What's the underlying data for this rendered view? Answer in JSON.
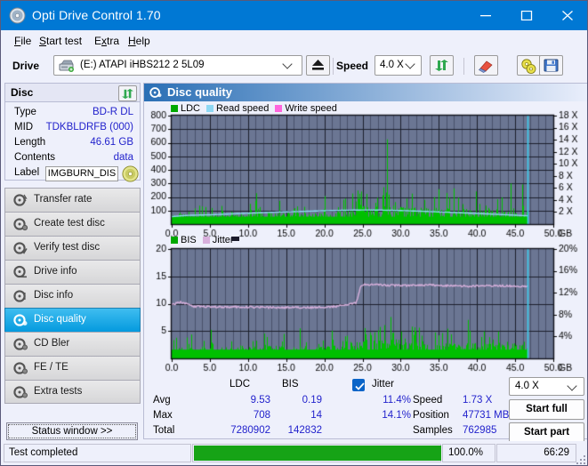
{
  "window": {
    "title": "Opti Drive Control 1.70",
    "icon": "disc-icon",
    "minimize_label": "Minimize",
    "maximize_label": "Maximize",
    "close_label": "Close"
  },
  "menu": [
    {
      "label": "File",
      "accel": "F"
    },
    {
      "label": "Start test",
      "accel": "S"
    },
    {
      "label": "Extra",
      "accel": "x"
    },
    {
      "label": "Help",
      "accel": "H"
    }
  ],
  "toolbar": {
    "drive_label": "Drive",
    "drive_value": "(E:)   ATAPI iHBS212   2 5L09",
    "eject_icon": "eject-icon",
    "speed_label": "Speed",
    "speed_value": "4.0 X",
    "refresh_icon": "refresh-icon",
    "erase_icon": "eraser-icon",
    "disc_tools_icon": "disc-tools-icon",
    "save_icon": "save-icon"
  },
  "disc": {
    "header": "Disc",
    "refresh_icon": "refresh-icon",
    "rows": [
      {
        "key": "Type",
        "value": "BD-R DL"
      },
      {
        "key": "MID",
        "value": "TDKBLDRFB (000)"
      },
      {
        "key": "Length",
        "value": "46.61 GB"
      },
      {
        "key": "Contents",
        "value": "data"
      }
    ],
    "label_key": "Label",
    "label_value": "IMGBURN_DIS",
    "label_icon": "disc-icon"
  },
  "nav": {
    "items": [
      {
        "label": "Transfer rate",
        "icon": "transfer-rate-icon",
        "active": false
      },
      {
        "label": "Create test disc",
        "icon": "create-test-disc-icon",
        "active": false
      },
      {
        "label": "Verify test disc",
        "icon": "verify-test-disc-icon",
        "active": false
      },
      {
        "label": "Drive info",
        "icon": "drive-info-icon",
        "active": false
      },
      {
        "label": "Disc info",
        "icon": "disc-info-icon",
        "active": false
      },
      {
        "label": "Disc quality",
        "icon": "disc-quality-icon",
        "active": true
      },
      {
        "label": "CD Bler",
        "icon": "cd-bler-icon",
        "active": false
      },
      {
        "label": "FE / TE",
        "icon": "fe-te-icon",
        "active": false
      },
      {
        "label": "Extra tests",
        "icon": "extra-tests-icon",
        "active": false
      }
    ],
    "status_window_label": "Status window >>"
  },
  "main": {
    "title": "Disc quality",
    "icon": "disc-quality-icon"
  },
  "results": {
    "col_ldc": "LDC",
    "col_bis": "BIS",
    "jitter_label": "Jitter",
    "jitter_checked": true,
    "rows": [
      {
        "name": "Avg",
        "ldc": "9.53",
        "bis": "0.19",
        "jitter": "11.4%"
      },
      {
        "name": "Max",
        "ldc": "708",
        "bis": "14",
        "jitter": "14.1%"
      },
      {
        "name": "Total",
        "ldc": "7280902",
        "bis": "142832",
        "jitter": ""
      }
    ],
    "speed_key": "Speed",
    "speed_value": "1.73 X",
    "position_key": "Position",
    "position_value": "47731 MB",
    "samples_key": "Samples",
    "samples_value": "762985",
    "speed_select": "4.0 X",
    "start_full_label": "Start full",
    "start_part_label": "Start part"
  },
  "statusbar": {
    "message": "Test completed",
    "progress_percent": 100.0,
    "progress_text": "100.0%",
    "elapsed": "66:29"
  },
  "colors": {
    "accent": "#0078d4",
    "ldc_green": "#00c000",
    "read_speed": "#8fd8f4",
    "write_speed": "#ff66dd",
    "jitter": "#d8b0dc",
    "plot_bg": "#6b7693",
    "progress_green": "#16a316",
    "value_blue": "#2222cc",
    "nav_active": "#049ade"
  },
  "chart_data": [
    {
      "type": "area",
      "name": "disc-quality-ldc-chart",
      "title": "",
      "xlabel": "GB",
      "ylabel": "",
      "xlim": [
        0.0,
        50.0
      ],
      "xticks": [
        "0.0",
        "5.0",
        "10.0",
        "15.0",
        "20.0",
        "25.0",
        "30.0",
        "35.0",
        "40.0",
        "45.0",
        "50.0"
      ],
      "ylim": [
        0,
        800
      ],
      "yticks": [
        100,
        200,
        300,
        400,
        500,
        600,
        700,
        800
      ],
      "y2lim": [
        0,
        18
      ],
      "y2ticks": [
        "2 X",
        "4 X",
        "6 X",
        "8 X",
        "10 X",
        "12 X",
        "14 X",
        "16 X",
        "18 X"
      ],
      "x_unit_label": "GB",
      "grid": true,
      "legend_position": "top-left",
      "legend": [
        {
          "label": "LDC",
          "color": "#00a800"
        },
        {
          "label": "Read speed",
          "color": "#8fd8f4"
        },
        {
          "label": "Write speed",
          "color": "#ff66dd"
        }
      ],
      "data_end_gb": 46.6,
      "series": [
        {
          "name": "LDC",
          "color": "#00c000",
          "type": "spikes",
          "x_start": 0.0,
          "x_end": 46.6,
          "baseline": 55,
          "peak_max": 708,
          "avg": 9.53,
          "envelope": [
            {
              "x": 0.0,
              "typical": 60,
              "peak": 340
            },
            {
              "x": 2.5,
              "typical": 60,
              "peak": 200
            },
            {
              "x": 5.0,
              "typical": 60,
              "peak": 210
            },
            {
              "x": 6.5,
              "typical": 65,
              "peak": 430
            },
            {
              "x": 10.0,
              "typical": 70,
              "peak": 320
            },
            {
              "x": 12.0,
              "typical": 80,
              "peak": 405
            },
            {
              "x": 15.0,
              "typical": 75,
              "peak": 290
            },
            {
              "x": 18.0,
              "typical": 70,
              "peak": 200
            },
            {
              "x": 21.0,
              "typical": 70,
              "peak": 260
            },
            {
              "x": 24.0,
              "typical": 110,
              "peak": 560
            },
            {
              "x": 25.5,
              "typical": 115,
              "peak": 470
            },
            {
              "x": 27.0,
              "typical": 115,
              "peak": 390
            },
            {
              "x": 28.5,
              "typical": 120,
              "peak": 700
            },
            {
              "x": 30.0,
              "typical": 105,
              "peak": 420
            },
            {
              "x": 33.0,
              "typical": 100,
              "peak": 440
            },
            {
              "x": 35.0,
              "typical": 100,
              "peak": 420
            },
            {
              "x": 38.0,
              "typical": 95,
              "peak": 390
            },
            {
              "x": 40.0,
              "typical": 95,
              "peak": 530
            },
            {
              "x": 42.0,
              "typical": 90,
              "peak": 350
            },
            {
              "x": 44.0,
              "typical": 85,
              "peak": 320
            },
            {
              "x": 46.6,
              "typical": 80,
              "peak": 300
            }
          ]
        },
        {
          "name": "Read speed",
          "color": "#8fd8f4",
          "type": "stepline",
          "axis": "right",
          "points": [
            {
              "x": 0.0,
              "v": 1.25
            },
            {
              "x": 2.0,
              "v": 1.45
            },
            {
              "x": 5.0,
              "v": 1.55
            },
            {
              "x": 8.0,
              "v": 1.7
            },
            {
              "x": 11.0,
              "v": 1.85
            },
            {
              "x": 14.0,
              "v": 2.0
            },
            {
              "x": 17.0,
              "v": 2.1
            },
            {
              "x": 20.0,
              "v": 2.22
            },
            {
              "x": 23.0,
              "v": 2.3
            },
            {
              "x": 25.0,
              "v": 2.34
            },
            {
              "x": 27.0,
              "v": 2.33
            },
            {
              "x": 30.0,
              "v": 2.25
            },
            {
              "x": 33.0,
              "v": 2.12
            },
            {
              "x": 36.0,
              "v": 1.98
            },
            {
              "x": 39.0,
              "v": 1.82
            },
            {
              "x": 42.0,
              "v": 1.66
            },
            {
              "x": 45.0,
              "v": 1.48
            },
            {
              "x": 46.6,
              "v": 1.38
            }
          ]
        }
      ],
      "marker_line": {
        "x": 46.6,
        "color": "#3fd0f0"
      }
    },
    {
      "type": "area",
      "name": "disc-quality-bis-chart",
      "title": "",
      "xlabel": "GB",
      "ylabel": "",
      "xlim": [
        0.0,
        50.0
      ],
      "xticks": [
        "0.0",
        "5.0",
        "10.0",
        "15.0",
        "20.0",
        "25.0",
        "30.0",
        "35.0",
        "40.0",
        "45.0",
        "50.0"
      ],
      "ylim": [
        0,
        20
      ],
      "yticks": [
        5,
        10,
        15,
        20
      ],
      "y2lim": [
        0,
        20
      ],
      "y2ticks": [
        "4%",
        "8%",
        "12%",
        "16%",
        "20%"
      ],
      "x_unit_label": "GB",
      "grid": true,
      "legend_position": "top-left",
      "legend": [
        {
          "label": "BIS",
          "color": "#00a800"
        },
        {
          "label": "Jitter",
          "color": "#d8b0dc"
        }
      ],
      "data_end_gb": 46.6,
      "series": [
        {
          "name": "BIS",
          "color": "#00c000",
          "type": "spikes",
          "x_start": 0.0,
          "x_end": 46.6,
          "baseline": 1.6,
          "peak_max": 14,
          "avg": 0.19,
          "envelope": [
            {
              "x": 0.0,
              "typical": 1.8,
              "peak": 9.0
            },
            {
              "x": 2.5,
              "typical": 1.6,
              "peak": 5.5
            },
            {
              "x": 5.0,
              "typical": 1.6,
              "peak": 5.2
            },
            {
              "x": 6.4,
              "typical": 1.7,
              "peak": 9.5
            },
            {
              "x": 9.0,
              "typical": 1.7,
              "peak": 6.2
            },
            {
              "x": 11.8,
              "typical": 2.0,
              "peak": 9.2
            },
            {
              "x": 14.0,
              "typical": 1.9,
              "peak": 6.0
            },
            {
              "x": 17.0,
              "typical": 1.8,
              "peak": 7.0
            },
            {
              "x": 20.0,
              "typical": 1.9,
              "peak": 6.0
            },
            {
              "x": 23.0,
              "typical": 2.2,
              "peak": 7.5
            },
            {
              "x": 25.0,
              "typical": 3.0,
              "peak": 8.5
            },
            {
              "x": 27.0,
              "typical": 2.8,
              "peak": 7.0
            },
            {
              "x": 28.8,
              "typical": 3.0,
              "peak": 9.5
            },
            {
              "x": 31.0,
              "typical": 2.6,
              "peak": 7.5
            },
            {
              "x": 34.0,
              "typical": 2.5,
              "peak": 7.0
            },
            {
              "x": 37.0,
              "typical": 2.4,
              "peak": 6.5
            },
            {
              "x": 40.0,
              "typical": 2.4,
              "peak": 7.5
            },
            {
              "x": 43.0,
              "typical": 2.3,
              "peak": 8.0
            },
            {
              "x": 45.5,
              "typical": 2.3,
              "peak": 8.2
            },
            {
              "x": 46.6,
              "typical": 2.0,
              "peak": 6.0
            }
          ]
        },
        {
          "name": "Jitter",
          "color": "#d8b0dc",
          "type": "line",
          "axis": "right",
          "points": [
            {
              "x": 0.0,
              "v": 9.8
            },
            {
              "x": 1.2,
              "v": 10.3
            },
            {
              "x": 2.0,
              "v": 9.9
            },
            {
              "x": 3.0,
              "v": 9.5
            },
            {
              "x": 6.0,
              "v": 9.4
            },
            {
              "x": 10.0,
              "v": 9.4
            },
            {
              "x": 14.0,
              "v": 9.3
            },
            {
              "x": 18.0,
              "v": 9.3
            },
            {
              "x": 21.0,
              "v": 9.4
            },
            {
              "x": 23.0,
              "v": 9.8
            },
            {
              "x": 24.2,
              "v": 10.2
            },
            {
              "x": 24.8,
              "v": 13.4
            },
            {
              "x": 26.0,
              "v": 13.5
            },
            {
              "x": 30.0,
              "v": 13.3
            },
            {
              "x": 34.0,
              "v": 13.4
            },
            {
              "x": 38.0,
              "v": 13.2
            },
            {
              "x": 42.0,
              "v": 13.3
            },
            {
              "x": 45.0,
              "v": 13.2
            },
            {
              "x": 46.6,
              "v": 13.2
            }
          ]
        }
      ],
      "marker_line": {
        "x": 46.6,
        "color": "#3fd0f0"
      }
    }
  ]
}
